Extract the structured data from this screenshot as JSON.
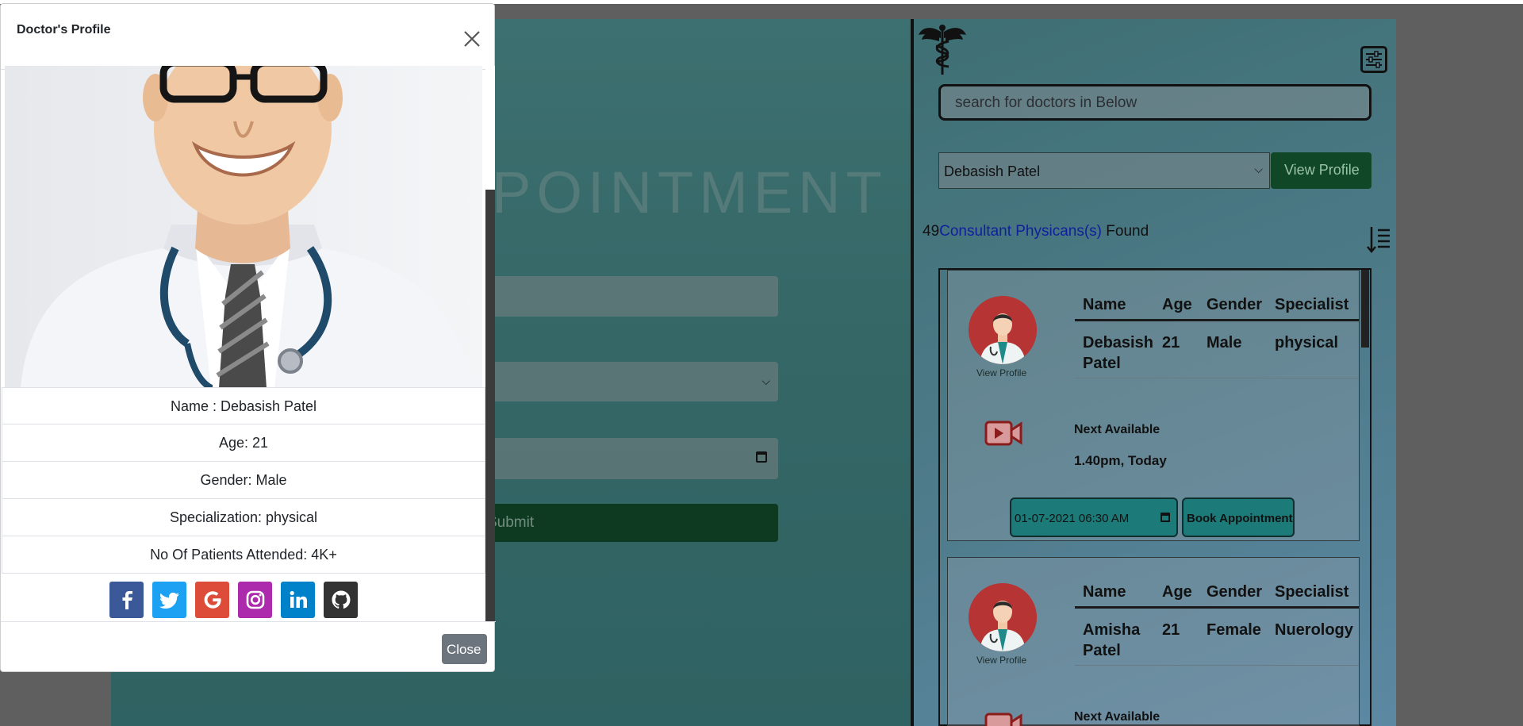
{
  "modal": {
    "title": "Doctor's Profile",
    "close_label": "Close",
    "info": [
      "Name : Debasish Patel",
      "Age: 21",
      "Gender: Male",
      "Specialization: physical",
      "No Of Patients Attended: 4K+"
    ],
    "social_icons": [
      "facebook-icon",
      "twitter-icon",
      "google-icon",
      "instagram-icon",
      "linkedin-icon",
      "github-icon"
    ],
    "social_colors": [
      "#3b5998",
      "#1da1f2",
      "#dd4b39",
      "#ac2bac",
      "#0082ca",
      "#333333"
    ]
  },
  "background": {
    "heading_fragment": "POINTMENT",
    "submit_label": "Submit"
  },
  "sidebar": {
    "search_placeholder": "search for doctors in Below",
    "selected_doctor": "Debasish Patel",
    "view_profile_label": "View Profile",
    "count": "49",
    "count_link": "Consultant Physicans(s)",
    "count_suffix": " Found"
  },
  "table_headers": {
    "name": "Name",
    "age": "Age",
    "gender": "Gender",
    "specialist": "Specialist"
  },
  "doctors": [
    {
      "name": "Debasish Patel",
      "age": "21",
      "gender": "Male",
      "specialist": "physical",
      "view_profile": "View Profile",
      "next_label": "Next Available",
      "next_time": "1.40pm, Today",
      "date_value": "01-07-2021 06:30  AM",
      "book_label": "Book Appointment"
    },
    {
      "name": "Amisha Patel",
      "age": "21",
      "gender": "Female",
      "specialist": "Nuerology",
      "view_profile": "View Profile",
      "next_label": "Next Available"
    }
  ]
}
